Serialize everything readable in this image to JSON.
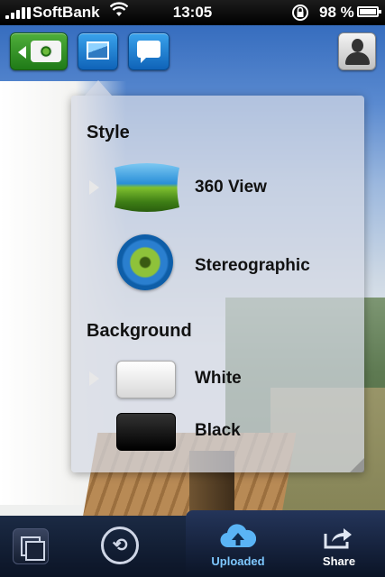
{
  "status_bar": {
    "carrier": "SoftBank",
    "time": "13:05",
    "battery": "98 %",
    "wifi_icon": "wifi-icon",
    "lock_icon": "rotation-lock-icon"
  },
  "toolbar": {
    "camera_icon": "camera-icon",
    "image_icon": "image-icon",
    "chat_icon": "chat-bubble-icon",
    "profile_icon": "person-icon"
  },
  "popover": {
    "style_title": "Style",
    "style_options": [
      {
        "label": "360 View",
        "selected": true
      },
      {
        "label": "Stereographic",
        "selected": false
      }
    ],
    "background_title": "Background",
    "background_options": [
      {
        "label": "White",
        "selected": true
      },
      {
        "label": "Black",
        "selected": false
      }
    ]
  },
  "tab_bar": {
    "tabs": [
      {
        "label": "",
        "icon": "duplicate-icon"
      },
      {
        "label": "",
        "icon": "rotate-icon"
      },
      {
        "label": "Uploaded",
        "icon": "cloud-upload-icon",
        "active": true
      },
      {
        "label": "Share",
        "icon": "share-icon"
      }
    ]
  },
  "colors": {
    "accent_blue": "#1a7fd6",
    "active_tab": "#7ec8ff",
    "camera_green": "#2f8f24"
  }
}
